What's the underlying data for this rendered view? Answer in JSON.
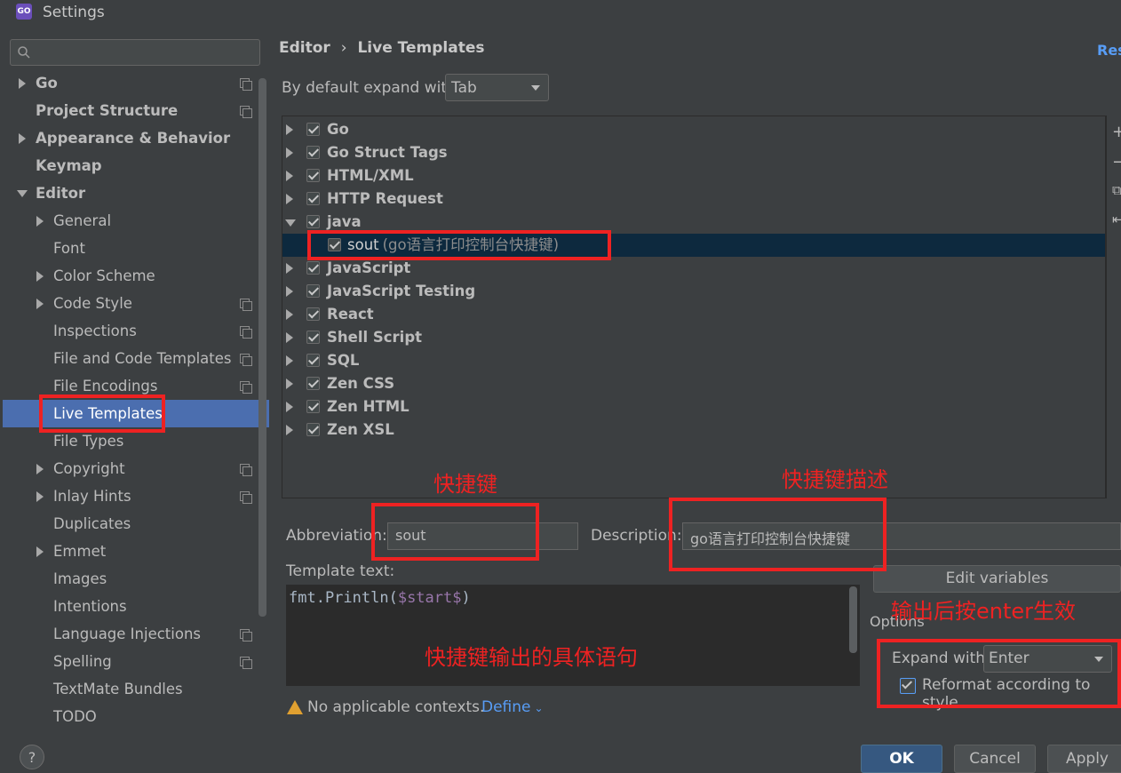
{
  "window": {
    "title": "Settings",
    "app_icon": "GO"
  },
  "sidebar": {
    "items": [
      {
        "label": "Go",
        "bold": true,
        "arrow": "right",
        "copy": true
      },
      {
        "label": "Project Structure",
        "bold": true,
        "arrow": "",
        "copy": true
      },
      {
        "label": "Appearance & Behavior",
        "bold": true,
        "arrow": "right",
        "copy": false
      },
      {
        "label": "Keymap",
        "bold": true,
        "arrow": "",
        "copy": false
      },
      {
        "label": "Editor",
        "bold": true,
        "arrow": "down",
        "copy": false
      },
      {
        "label": "General",
        "bold": false,
        "arrow": "right",
        "copy": false
      },
      {
        "label": "Font",
        "bold": false,
        "arrow": "",
        "copy": false
      },
      {
        "label": "Color Scheme",
        "bold": false,
        "arrow": "right",
        "copy": false
      },
      {
        "label": "Code Style",
        "bold": false,
        "arrow": "right",
        "copy": true
      },
      {
        "label": "Inspections",
        "bold": false,
        "arrow": "",
        "copy": true
      },
      {
        "label": "File and Code Templates",
        "bold": false,
        "arrow": "",
        "copy": true
      },
      {
        "label": "File Encodings",
        "bold": false,
        "arrow": "",
        "copy": true
      },
      {
        "label": "Live Templates",
        "bold": false,
        "arrow": "",
        "copy": false,
        "selected": true
      },
      {
        "label": "File Types",
        "bold": false,
        "arrow": "",
        "copy": false
      },
      {
        "label": "Copyright",
        "bold": false,
        "arrow": "right",
        "copy": true
      },
      {
        "label": "Inlay Hints",
        "bold": false,
        "arrow": "right",
        "copy": true
      },
      {
        "label": "Duplicates",
        "bold": false,
        "arrow": "",
        "copy": false
      },
      {
        "label": "Emmet",
        "bold": false,
        "arrow": "right",
        "copy": false
      },
      {
        "label": "Images",
        "bold": false,
        "arrow": "",
        "copy": false
      },
      {
        "label": "Intentions",
        "bold": false,
        "arrow": "",
        "copy": false
      },
      {
        "label": "Language Injections",
        "bold": false,
        "arrow": "",
        "copy": true
      },
      {
        "label": "Spelling",
        "bold": false,
        "arrow": "",
        "copy": true
      },
      {
        "label": "TextMate Bundles",
        "bold": false,
        "arrow": "",
        "copy": false
      },
      {
        "label": "TODO",
        "bold": false,
        "arrow": "",
        "copy": false
      }
    ]
  },
  "header": {
    "breadcrumb_parent": "Editor",
    "breadcrumb_sep": "›",
    "breadcrumb_current": "Live Templates",
    "reset": "Res"
  },
  "expand_default": {
    "label": "By default expand with",
    "value": "Tab"
  },
  "templates": {
    "groups": [
      {
        "label": "Go",
        "expanded": false
      },
      {
        "label": "Go Struct Tags",
        "expanded": false
      },
      {
        "label": "HTML/XML",
        "expanded": false
      },
      {
        "label": "HTTP Request",
        "expanded": false
      },
      {
        "label": "java",
        "expanded": true
      },
      {
        "label": "JavaScript",
        "expanded": false
      },
      {
        "label": "JavaScript Testing",
        "expanded": false
      },
      {
        "label": "React",
        "expanded": false
      },
      {
        "label": "Shell Script",
        "expanded": false
      },
      {
        "label": "SQL",
        "expanded": false
      },
      {
        "label": "Zen CSS",
        "expanded": false
      },
      {
        "label": "Zen HTML",
        "expanded": false
      },
      {
        "label": "Zen XSL",
        "expanded": false
      }
    ],
    "child": {
      "abbr": "sout",
      "desc": "(go语言打印控制台快捷键)"
    },
    "toolbar": [
      "+",
      "−",
      "⧉",
      "⇤"
    ]
  },
  "annotations": {
    "shortcut": "快捷键",
    "shortcut_desc": "快捷键描述",
    "output_stmt": "快捷键输出的具体语句",
    "enter_effect": "输出后按enter生效"
  },
  "editor": {
    "abbr_label": "Abbreviation:",
    "abbr_value": "sout",
    "desc_label": "Description:",
    "desc_value": "go语言打印控制台快捷键",
    "template_label": "Template text:",
    "template_code": "fmt.Println($start$)",
    "edit_vars": "Edit variables",
    "options_label": "Options",
    "expand_with_label": "Expand with",
    "expand_with_value": "Enter",
    "reformat_label": "Reformat according to style",
    "warning": "No applicable contexts.",
    "define": "Define"
  },
  "footer": {
    "help": "?",
    "ok": "OK",
    "cancel": "Cancel",
    "apply": "Apply"
  }
}
